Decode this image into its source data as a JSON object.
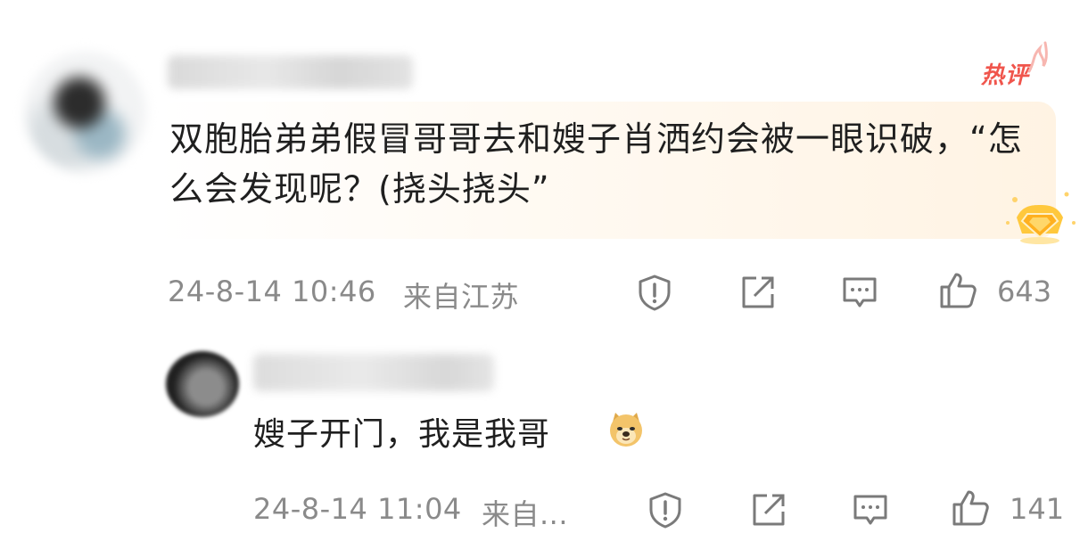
{
  "comment": {
    "badge": "热评",
    "text": "双胞胎弟弟假冒哥哥去和嫂子肖洒约会被一眼识破，“怎么会发现呢？(挠头挠头”",
    "timestamp": "24-8-14 10:46",
    "location": "来自江苏",
    "like_count": "643"
  },
  "reply": {
    "text": "嫂子开门，我是我哥",
    "emoji": "doge-emoji",
    "timestamp": "24-8-14 11:04",
    "location": "来自...",
    "like_count": "141"
  },
  "icons": {
    "report": "shield-exclamation-icon",
    "share": "share-out-icon",
    "reply": "comment-bubble-icon",
    "like": "thumbs-up-icon"
  },
  "colors": {
    "hot_badge": "#f0554c",
    "meta_text": "#8a8a8a",
    "bubble_tint": "#fff3e3"
  }
}
